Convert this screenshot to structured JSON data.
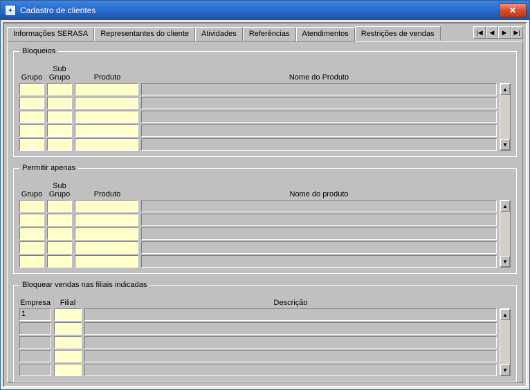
{
  "window": {
    "title": "Cadastro de clientes"
  },
  "tabs": [
    {
      "label": "Informações SERASA"
    },
    {
      "label": "Representantes do cliente"
    },
    {
      "label": "Atividades"
    },
    {
      "label": "Referências"
    },
    {
      "label": "Atendimentos"
    },
    {
      "label": "Restrições de vendas"
    }
  ],
  "active_tab_index": 5,
  "nav": {
    "first": "|◀",
    "prev": "◀",
    "next": "▶",
    "last": "▶|"
  },
  "groups": {
    "bloqueios": {
      "legend": "Bloqueios",
      "headers": {
        "grupo": "Grupo",
        "sub": "Sub\nGrupo",
        "produto": "Produto",
        "nome": "Nome do Produto"
      },
      "rows": [
        {
          "grupo": "",
          "sub": "",
          "produto": "",
          "nome": ""
        },
        {
          "grupo": "",
          "sub": "",
          "produto": "",
          "nome": ""
        },
        {
          "grupo": "",
          "sub": "",
          "produto": "",
          "nome": ""
        },
        {
          "grupo": "",
          "sub": "",
          "produto": "",
          "nome": ""
        },
        {
          "grupo": "",
          "sub": "",
          "produto": "",
          "nome": ""
        }
      ]
    },
    "permitir": {
      "legend": "Permitir apenas",
      "headers": {
        "grupo": "Grupo",
        "sub": "Sub\nGrupo",
        "produto": "Produto",
        "nome": "Nome do produto"
      },
      "rows": [
        {
          "grupo": "",
          "sub": "",
          "produto": "",
          "nome": ""
        },
        {
          "grupo": "",
          "sub": "",
          "produto": "",
          "nome": ""
        },
        {
          "grupo": "",
          "sub": "",
          "produto": "",
          "nome": ""
        },
        {
          "grupo": "",
          "sub": "",
          "produto": "",
          "nome": ""
        },
        {
          "grupo": "",
          "sub": "",
          "produto": "",
          "nome": ""
        }
      ]
    },
    "bloquear_filiais": {
      "legend": "Bloquear vendas nas filiais indicadas",
      "headers": {
        "empresa": "Empresa",
        "filial": "Filial",
        "descricao": "Descrição"
      },
      "rows": [
        {
          "empresa": "1",
          "filial": "",
          "descricao": ""
        },
        {
          "empresa": "",
          "filial": "",
          "descricao": ""
        },
        {
          "empresa": "",
          "filial": "",
          "descricao": ""
        },
        {
          "empresa": "",
          "filial": "",
          "descricao": ""
        },
        {
          "empresa": "",
          "filial": "",
          "descricao": ""
        }
      ]
    }
  }
}
